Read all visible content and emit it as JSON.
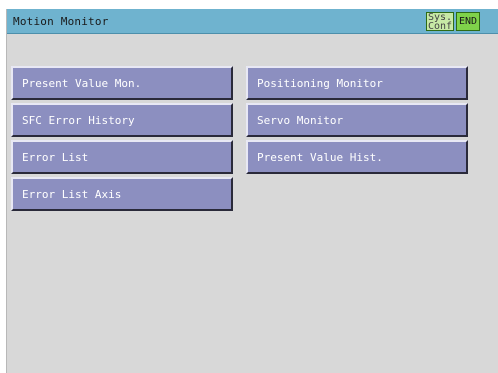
{
  "window": {
    "title": "Motion Monitor"
  },
  "toolbar": {
    "sys_conf_label": "Sys.\nConf",
    "end_label": "END"
  },
  "menu": {
    "left": [
      {
        "label": "Present Value Mon."
      },
      {
        "label": "SFC Error History"
      },
      {
        "label": "Error List"
      },
      {
        "label": "Error List Axis"
      }
    ],
    "right": [
      {
        "label": "Positioning Monitor"
      },
      {
        "label": "Servo Monitor"
      },
      {
        "label": "Present Value Hist."
      }
    ]
  },
  "colors": {
    "titlebar": "#6fb3cf",
    "button_face": "#8c8fc0",
    "end_button": "#7fd24a",
    "background": "#d8d8d8"
  }
}
